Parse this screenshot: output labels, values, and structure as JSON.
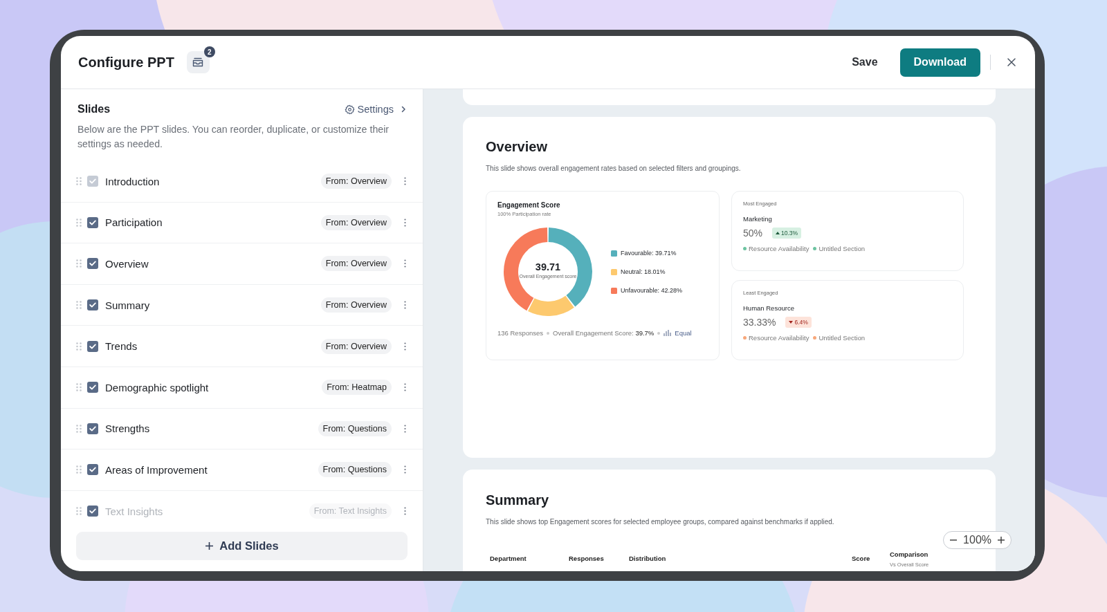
{
  "header": {
    "title": "Configure PPT",
    "queue_badge": "2",
    "save": "Save",
    "download": "Download"
  },
  "slides_panel": {
    "title": "Slides",
    "settings": "Settings",
    "description": "Below are the PPT slides. You can reorder, duplicate, or customize their settings as needed.",
    "items": [
      {
        "label": "Introduction",
        "source": "From: Overview",
        "checked": true,
        "disabled": true
      },
      {
        "label": "Participation",
        "source": "From: Overview",
        "checked": true,
        "disabled": false
      },
      {
        "label": "Overview",
        "source": "From: Overview",
        "checked": true,
        "disabled": false
      },
      {
        "label": "Summary",
        "source": "From: Overview",
        "checked": true,
        "disabled": false
      },
      {
        "label": "Trends",
        "source": "From: Overview",
        "checked": true,
        "disabled": false
      },
      {
        "label": "Demographic spotlight",
        "source": "From: Heatmap",
        "checked": true,
        "disabled": false
      },
      {
        "label": "Strengths",
        "source": "From: Questions",
        "checked": true,
        "disabled": false
      },
      {
        "label": "Areas of Improvement",
        "source": "From: Questions",
        "checked": true,
        "disabled": false
      },
      {
        "label": "Text Insights",
        "source": "From: Text Insights",
        "checked": true,
        "disabled": false
      }
    ],
    "add_button": "Add Slides"
  },
  "overview": {
    "title": "Overview",
    "description": "This slide shows overall engagement rates based on selected filters and groupings.",
    "score_card": {
      "title": "Engagement Score",
      "subtitle": "100% Participation rate",
      "center_value": "39.71",
      "center_caption": "Overall Engagement score",
      "chart_data": {
        "type": "donut",
        "values": [
          39.71,
          18.01,
          42.28
        ]
      },
      "legend": [
        {
          "label": "Favourable: 39.71%",
          "color": "#55b0bb"
        },
        {
          "label": "Neutral: 18.01%",
          "color": "#fdc96e"
        },
        {
          "label": "Unfavourable: 42.28%",
          "color": "#f77a5a"
        }
      ],
      "responses": "136 Responses",
      "overall": "Overall Engagement Score: **39.7%**",
      "benchmark": "Equal"
    },
    "groups": [
      {
        "heading": "Most Engaged",
        "name": "Marketing",
        "score": "50%",
        "change": "10.3%",
        "up": true,
        "tags": [
          "Resource Availability",
          "Untitled Section"
        ]
      },
      {
        "heading": "Least Engaged",
        "name": "Human Resource",
        "score": "33.33%",
        "change": "6.4%",
        "up": false,
        "tags": [
          "Resource Availability",
          "Untitled Section"
        ]
      }
    ]
  },
  "summary": {
    "title": "Summary",
    "description": "This slide shows top Engagement scores for selected employee groups, compared against benchmarks if applied.",
    "columns": [
      {
        "label": "Department"
      },
      {
        "label": "Responses"
      },
      {
        "label": "Distribution"
      },
      {
        "label": "Score"
      },
      {
        "label": "Comparison",
        "sublabel": "Vs Overall Score"
      }
    ]
  },
  "zoom": {
    "value": "100%"
  }
}
